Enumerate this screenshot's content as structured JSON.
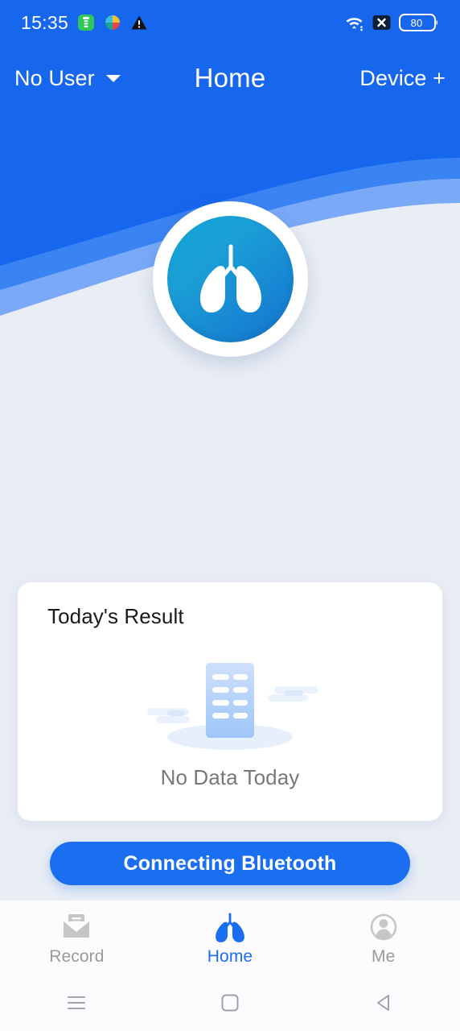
{
  "status_bar": {
    "clock": "15:35",
    "battery_level": "80",
    "icons": {
      "notification_green": "clipboard-icon",
      "notification_color": "umbrella-icon",
      "warning": "warning-triangle-icon",
      "wifi": "wifi-icon",
      "signal_off": "no-signal-icon",
      "battery": "battery-icon"
    }
  },
  "app_bar": {
    "user_label": "No User",
    "caret_icon": "chevron-down-icon",
    "title": "Home",
    "device_action": "Device +"
  },
  "brand": {
    "logo_icon": "lungs-icon"
  },
  "card": {
    "title": "Today's Result",
    "empty_illustration_icon": "empty-document-icon",
    "empty_text": "No Data Today"
  },
  "primary_button": {
    "label": "Connecting Bluetooth"
  },
  "tab_bar": {
    "items": [
      {
        "label": "Record",
        "icon": "envelope-icon",
        "active": false
      },
      {
        "label": "Home",
        "icon": "lungs-icon",
        "active": true
      },
      {
        "label": "Me",
        "icon": "person-circle-icon",
        "active": false
      }
    ]
  },
  "system_nav": {
    "recents_icon": "menu-icon",
    "home_icon": "square-icon",
    "back_icon": "triangle-back-icon"
  },
  "colors": {
    "brand_blue": "#1a6ef0",
    "header_blue": "#1766ee",
    "wave_mid_blue": "#3a83f2",
    "wave_light_blue": "#79a9f7",
    "page_bg": "#e9edf4",
    "card_bg": "#ffffff",
    "muted_text": "#787878",
    "tab_inactive": "#9a9a9a",
    "logo_gradient_start": "#12a5d8",
    "logo_gradient_end": "#1473cf"
  }
}
